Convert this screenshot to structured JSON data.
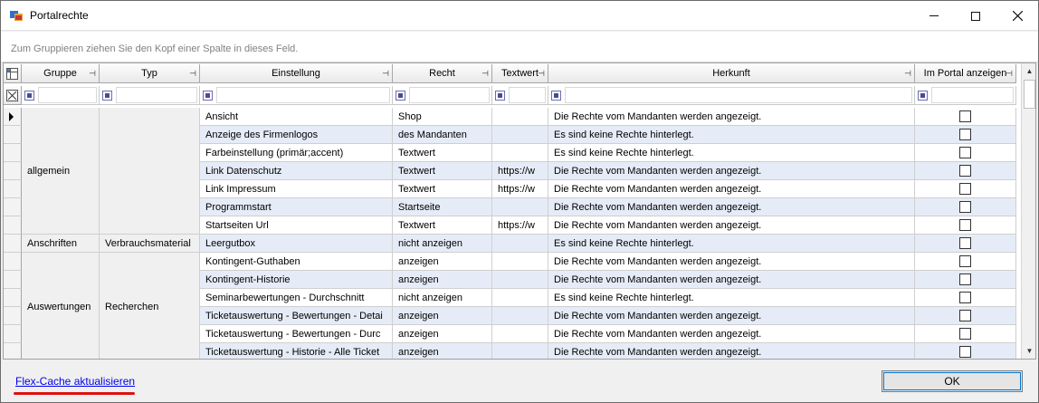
{
  "window": {
    "title": "Portalrechte",
    "icons": {
      "app": "app-window-icon",
      "minimize": "minimize-icon",
      "maximize": "maximize-icon",
      "close": "close-icon"
    }
  },
  "group_hint": "Zum Gruppieren ziehen Sie den Kopf einer Spalte in dieses Feld.",
  "columns": [
    "Gruppe",
    "Typ",
    "Einstellung",
    "Recht",
    "Textwert",
    "Herkunft",
    "Im Portal anzeigen"
  ],
  "groups": [
    {
      "gruppe": "allgemein",
      "typ": ""
    },
    {
      "gruppe": "Anschriften",
      "typ": "Verbrauchsmaterial"
    },
    {
      "gruppe": "Auswertungen",
      "typ": "Recherchen"
    }
  ],
  "rows": [
    {
      "einstellung": "Ansicht",
      "recht": "Shop",
      "textwert": "",
      "herkunft": "Die Rechte vom Mandanten werden angezeigt.",
      "im_portal": false
    },
    {
      "einstellung": "Anzeige des Firmenlogos",
      "recht": "des Mandanten",
      "textwert": "",
      "herkunft": "Es sind keine Rechte hinterlegt.",
      "im_portal": false
    },
    {
      "einstellung": "Farbeinstellung (primär;accent)",
      "recht": "Textwert",
      "textwert": "",
      "herkunft": "Es sind keine Rechte hinterlegt.",
      "im_portal": false
    },
    {
      "einstellung": "Link Datenschutz",
      "recht": "Textwert",
      "textwert": "https://w",
      "herkunft": "Die Rechte vom Mandanten werden angezeigt.",
      "im_portal": false
    },
    {
      "einstellung": "Link Impressum",
      "recht": "Textwert",
      "textwert": "https://w",
      "herkunft": "Die Rechte vom Mandanten werden angezeigt.",
      "im_portal": false
    },
    {
      "einstellung": "Programmstart",
      "recht": "Startseite",
      "textwert": "",
      "herkunft": "Die Rechte vom Mandanten werden angezeigt.",
      "im_portal": false
    },
    {
      "einstellung": "Startseiten Url",
      "recht": "Textwert",
      "textwert": "https://w",
      "herkunft": "Die Rechte vom Mandanten werden angezeigt.",
      "im_portal": false
    },
    {
      "einstellung": "Leergutbox",
      "recht": "nicht anzeigen",
      "textwert": "",
      "herkunft": "Es sind keine Rechte hinterlegt.",
      "im_portal": false
    },
    {
      "einstellung": "Kontingent-Guthaben",
      "recht": "anzeigen",
      "textwert": "",
      "herkunft": "Die Rechte vom Mandanten werden angezeigt.",
      "im_portal": false
    },
    {
      "einstellung": "Kontingent-Historie",
      "recht": "anzeigen",
      "textwert": "",
      "herkunft": "Die Rechte vom Mandanten werden angezeigt.",
      "im_portal": false
    },
    {
      "einstellung": "Seminarbewertungen - Durchschnitt",
      "recht": "nicht anzeigen",
      "textwert": "",
      "herkunft": "Es sind keine Rechte hinterlegt.",
      "im_portal": false
    },
    {
      "einstellung": "Ticketauswertung - Bewertungen - Detai",
      "recht": "anzeigen",
      "textwert": "",
      "herkunft": "Die Rechte vom Mandanten werden angezeigt.",
      "im_portal": false
    },
    {
      "einstellung": "Ticketauswertung - Bewertungen - Durc",
      "recht": "anzeigen",
      "textwert": "",
      "herkunft": "Die Rechte vom Mandanten werden angezeigt.",
      "im_portal": false
    },
    {
      "einstellung": "Ticketauswertung - Historie - Alle Ticket",
      "recht": "anzeigen",
      "textwert": "",
      "herkunft": "Die Rechte vom Mandanten werden angezeigt.",
      "im_portal": false
    }
  ],
  "footer": {
    "link_label": "Flex-Cache aktualisieren",
    "ok_label": "OK"
  },
  "colors": {
    "highlight_underline": "#e01010",
    "link": "#0000ee",
    "alt_row": "#e6ecf7"
  }
}
